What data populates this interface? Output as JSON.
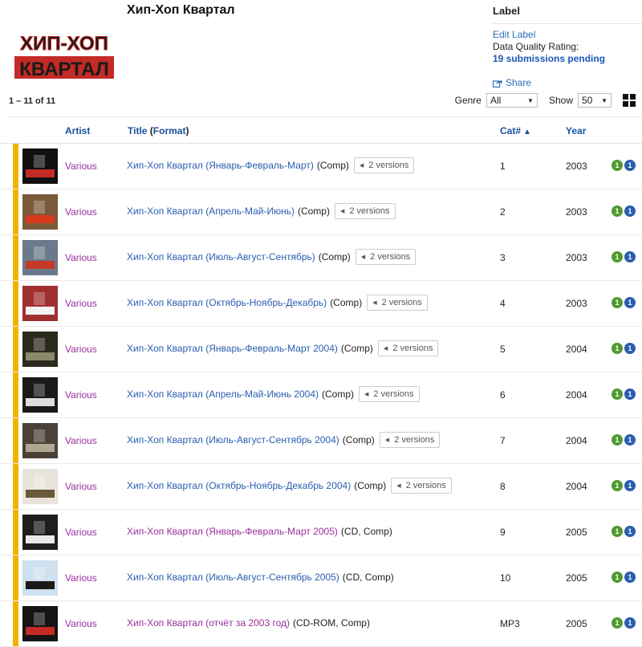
{
  "header": {
    "title": "Хип-Хоп Квартал",
    "logo_text_top": "ХИП-ХОП",
    "logo_text_bottom": "КВАРТАЛ"
  },
  "sidebar": {
    "section_label": "Label",
    "edit_link": "Edit Label",
    "data_quality": "Data Quality Rating:",
    "pending": "19 submissions pending",
    "share": "Share"
  },
  "listing": {
    "count": "1 – 11 of 11",
    "genre_label": "Genre",
    "genre_value": "All",
    "show_label": "Show",
    "show_value": "50"
  },
  "table": {
    "columns": {
      "artist": "Artist",
      "title": "Title",
      "format": "Format",
      "cat": "Cat#",
      "year": "Year"
    },
    "rows": [
      {
        "artist": "Various",
        "title": "Хип-Хоп Квартал (Январь-Февраль-Март)",
        "format": "(Comp)",
        "versions": "2 versions",
        "cat": "1",
        "year": "2003",
        "b1": "1",
        "b2": "1",
        "visited": false,
        "thumb": {
          "bg": "#101010",
          "accent": "#c42a26"
        }
      },
      {
        "artist": "Various",
        "title": "Хип-Хоп Квартал (Апрель-Май-Июнь)",
        "format": "(Comp)",
        "versions": "2 versions",
        "cat": "2",
        "year": "2003",
        "b1": "1",
        "b2": "1",
        "visited": false,
        "thumb": {
          "bg": "#7a5a3a",
          "accent": "#d83a1c"
        }
      },
      {
        "artist": "Various",
        "title": "Хип-Хоп Квартал (Июль-Август-Сентябрь)",
        "format": "(Comp)",
        "versions": "2 versions",
        "cat": "3",
        "year": "2003",
        "b1": "1",
        "b2": "1",
        "visited": false,
        "thumb": {
          "bg": "#6a7a8a",
          "accent": "#c43a26"
        }
      },
      {
        "artist": "Various",
        "title": "Хип-Хоп Квартал (Октябрь-Ноябрь-Декабрь)",
        "format": "(Comp)",
        "versions": "2 versions",
        "cat": "4",
        "year": "2003",
        "b1": "1",
        "b2": "1",
        "visited": false,
        "thumb": {
          "bg": "#a03030",
          "accent": "#f2f2f2"
        }
      },
      {
        "artist": "Various",
        "title": "Хип-Хоп Квартал (Январь-Февраль-Март 2004)",
        "format": "(Comp)",
        "versions": "2 versions",
        "cat": "5",
        "year": "2004",
        "b1": "1",
        "b2": "1",
        "visited": false,
        "thumb": {
          "bg": "#2c2a1c",
          "accent": "#8a8a6a"
        }
      },
      {
        "artist": "Various",
        "title": "Хип-Хоп Квартал (Апрель-Май-Июнь 2004)",
        "format": "(Comp)",
        "versions": "2 versions",
        "cat": "6",
        "year": "2004",
        "b1": "1",
        "b2": "1",
        "visited": false,
        "thumb": {
          "bg": "#1a1a1a",
          "accent": "#dddddd"
        }
      },
      {
        "artist": "Various",
        "title": "Хип-Хоп Квартал (Июль-Август-Сентябрь 2004)",
        "format": "(Comp)",
        "versions": "2 versions",
        "cat": "7",
        "year": "2004",
        "b1": "1",
        "b2": "1",
        "visited": false,
        "thumb": {
          "bg": "#4a4238",
          "accent": "#b0a890"
        }
      },
      {
        "artist": "Various",
        "title": "Хип-Хоп Квартал (Октябрь-Ноябрь-Декабрь 2004)",
        "format": "(Comp)",
        "versions": "2 versions",
        "cat": "8",
        "year": "2004",
        "b1": "1",
        "b2": "1",
        "visited": false,
        "thumb": {
          "bg": "#e8e4dc",
          "accent": "#6a5a3a"
        }
      },
      {
        "artist": "Various",
        "title": "Хип-Хоп Квартал (Январь-Февраль-Март 2005)",
        "format": "(CD, Comp)",
        "versions": "",
        "cat": "9",
        "year": "2005",
        "b1": "1",
        "b2": "1",
        "visited": true,
        "thumb": {
          "bg": "#1e1e1e",
          "accent": "#e8e8e8"
        }
      },
      {
        "artist": "Various",
        "title": "Хип-Хоп Квартал (Июль-Август-Сентябрь 2005)",
        "format": "(CD, Comp)",
        "versions": "",
        "cat": "10",
        "year": "2005",
        "b1": "1",
        "b2": "1",
        "visited": false,
        "thumb": {
          "bg": "#cfe0ee",
          "accent": "#1a1a1a"
        }
      },
      {
        "artist": "Various",
        "title": "Хип-Хоп Квартал (отчёт за 2003 год)",
        "format": "(CD-ROM, Comp)",
        "versions": "",
        "cat": "MP3",
        "year": "2005",
        "b1": "1",
        "b2": "1",
        "visited": true,
        "thumb": {
          "bg": "#141414",
          "accent": "#c42a26"
        }
      }
    ]
  },
  "colors": {
    "accent_bar": "#f0b400",
    "link": "#2a5db0",
    "visited": "#9a2f9e",
    "badge_green": "#4f9a2f",
    "badge_blue": "#2a5db0"
  }
}
